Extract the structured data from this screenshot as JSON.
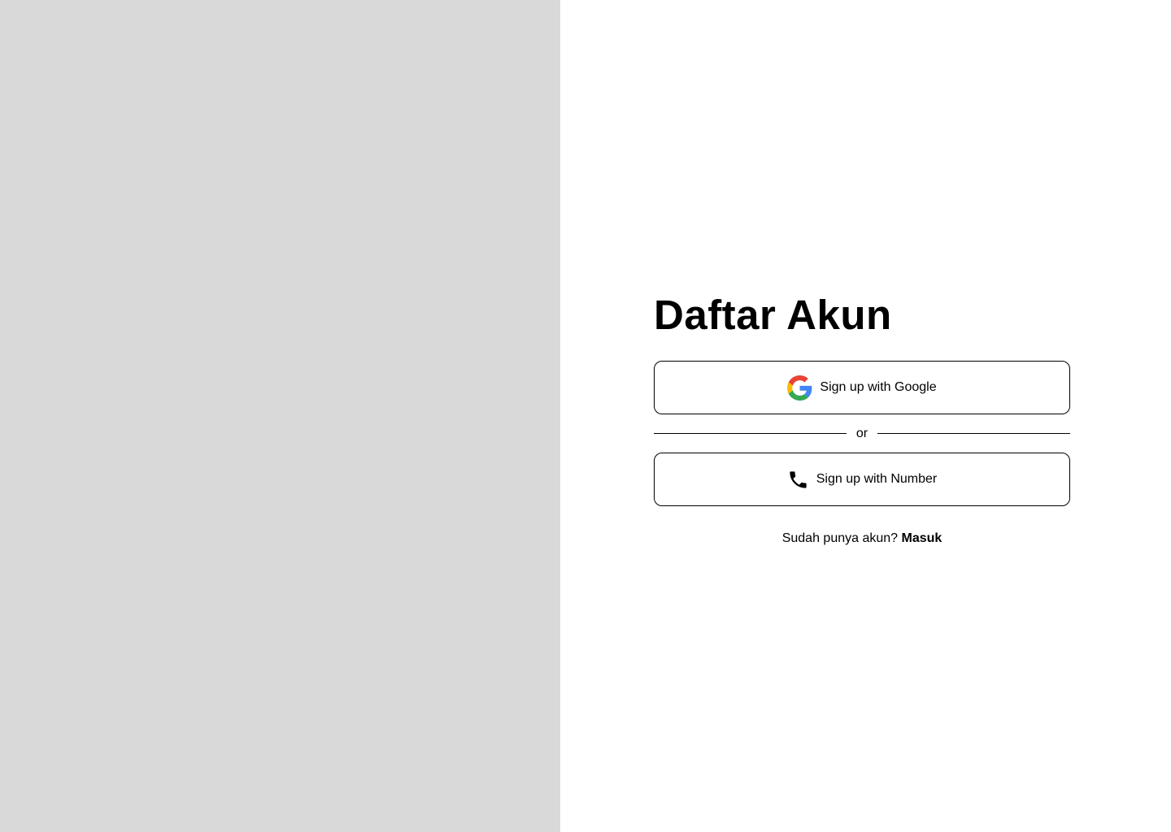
{
  "colors": {
    "left_panel_bg": "#d9d9d9",
    "right_panel_bg": "#ffffff",
    "text": "#000000",
    "border": "#000000",
    "google_blue": "#4285F4",
    "google_red": "#EA4335",
    "google_yellow": "#FBBC05",
    "google_green": "#34A853"
  },
  "signup": {
    "title": "Daftar Akun",
    "google_button": {
      "icon": "google-icon",
      "label": "Sign up with Google"
    },
    "divider_text": "or",
    "number_button": {
      "icon": "phone-icon",
      "label": "Sign up with Number"
    },
    "signin_prompt": "Sudah punya akun?",
    "signin_link": "Masuk"
  }
}
